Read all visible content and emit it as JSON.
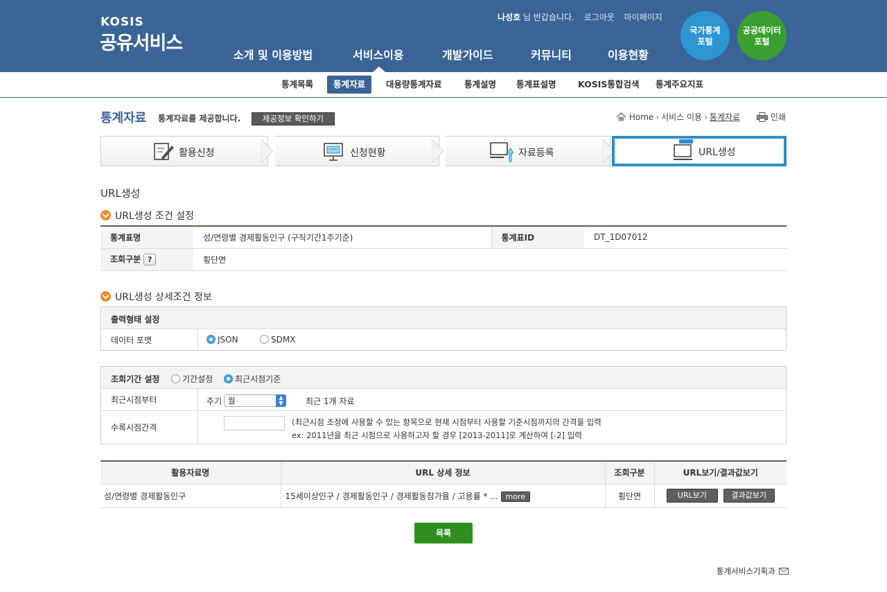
{
  "header": {
    "logo_top": "KOSIS",
    "logo_main": "공유서비스",
    "user_name": "나성호",
    "greeting": " 님 반갑습니다.",
    "logout": "로그아웃",
    "mypage": "마이페이지",
    "gnb": [
      "소개 및 이용방법",
      "서비스이용",
      "개발가이드",
      "커뮤니티",
      "이용현황"
    ],
    "portal1": "국가통계\n포털",
    "portal2": "공공데이터\n포털",
    "colors": {
      "header_bg": "#3a6496",
      "portal1": "#2e95d3",
      "portal2": "#3a9f2e"
    }
  },
  "subnav": [
    "통계목록",
    "통계자료",
    "대용량통계자료",
    "통계설명",
    "통계표설명",
    "KOSIS통합검색",
    "통계주요지표"
  ],
  "title": {
    "main": "통계자료",
    "desc": "통계자료를 제공합니다.",
    "button": "제공정보 확인하기",
    "crumb_home": "Home",
    "crumb_service": "서비스 이용",
    "crumb_current": "통계자료",
    "print": "인쇄"
  },
  "steps": [
    "활용신청",
    "신청현황",
    "자료등록",
    "URL생성"
  ],
  "url_heading": "URL생성",
  "section1": {
    "title": "URL생성 조건 설정",
    "row1_h1": "통계표명",
    "row1_v1": "성/연령별 경제활동인구 (구직기간1주기준)",
    "row1_h2": "통계표ID",
    "row1_v2": "DT_1D07012",
    "row2_h": "조회구분",
    "row2_help": "?",
    "row2_v": "횡단면"
  },
  "section2": {
    "title": "URL생성 상세조건 정보",
    "output_title": "출력형태 설정",
    "format_label": "데이터 포맷",
    "format_json": "JSON",
    "format_sdmx": "SDMX",
    "period_title": "조회기간 설정",
    "period_opt1": "기간설정",
    "period_opt2": "최근시점기준",
    "recent_label": "최근시점부터",
    "cycle_label": "주기",
    "cycle_value": "월",
    "recent_text": "최근 1개 자료",
    "interval_label": "수록시점간격",
    "interval_line1": "(최근시점 조정에 사용할 수 있는 항목으로 현재 시점부터 사용할 기준시점까지의 간격을 입력",
    "interval_line2": "ex: 2011년을 최근 시점으로 사용하고자 할 경우 [2013-2011]로 계산하여 [-2] 입력"
  },
  "results": {
    "headers": [
      "활용자료명",
      "URL 상세 정보",
      "조회구분",
      "URL보기/결과값보기"
    ],
    "row": {
      "name": "성/연령별 경제활동인구",
      "detail": "15세이상인구 / 경제활동인구 / 경제활동참가율 / 고용률 * ...",
      "more": "more",
      "type": "횡단면",
      "btn_url": "URL보기",
      "btn_result": "결과값보기"
    }
  },
  "list_button": "목록",
  "footer_link": "통계서비스기획과"
}
